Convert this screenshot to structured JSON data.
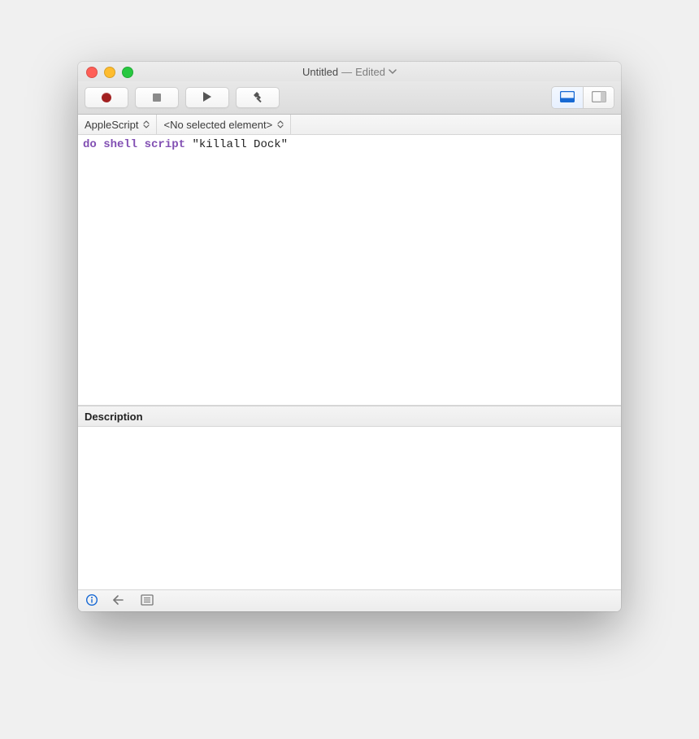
{
  "window": {
    "title_main": "Untitled",
    "title_sep": " — ",
    "title_status": "Edited"
  },
  "toolbar": {
    "record": "record-icon",
    "stop": "stop-icon",
    "run": "play-icon",
    "compile": "hammer-icon",
    "view_result_pane": "bottom-pane-icon",
    "view_side_pane": "side-pane-icon"
  },
  "navigator": {
    "language_label": "AppleScript",
    "element_label": "<No selected element>"
  },
  "script": {
    "keyword": "do shell script",
    "string": "\"killall Dock\""
  },
  "description": {
    "header": "Description",
    "text": ""
  },
  "resultsbar": {
    "info": "info-icon",
    "reply": "reply-icon",
    "log": "log-icon"
  },
  "colors": {
    "keyword": "#8250b3",
    "command": "#1060b0",
    "accent_blue": "#1769d4"
  }
}
